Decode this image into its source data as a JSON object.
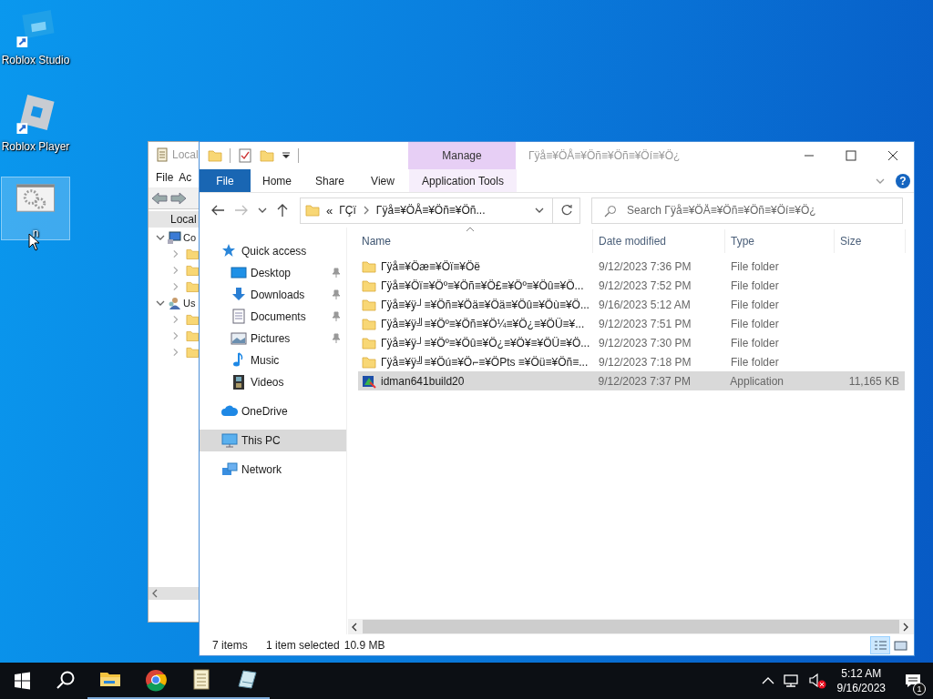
{
  "desktop_icons": [
    {
      "label": "Roblox Studio",
      "kind": "studio",
      "selected": false
    },
    {
      "label": "Roblox Player",
      "kind": "player",
      "selected": false
    },
    {
      "label": "n",
      "kind": "settings",
      "selected": true
    }
  ],
  "background_window": {
    "title": "Local",
    "menu": [
      "File",
      "Ac"
    ],
    "tree_label": "Local",
    "tree": [
      {
        "label": "Co",
        "kind": "computer",
        "expanded": true,
        "children": [
          {
            "expanded": false
          },
          {
            "expanded": false
          },
          {
            "expanded": false
          }
        ]
      },
      {
        "label": "Us",
        "kind": "users",
        "expanded": true,
        "children": [
          {
            "expanded": false
          },
          {
            "expanded": false
          },
          {
            "expanded": false
          }
        ]
      }
    ]
  },
  "explorer": {
    "title": "Γÿå≡¥ÖÅ≡¥Öñ≡¥Öñ≡¥Öí≡¥Ö¿",
    "contextual_header": "Manage",
    "tabs": [
      {
        "label": "File",
        "kind": "file",
        "selected": false
      },
      {
        "label": "Home",
        "kind": "plain",
        "selected": false
      },
      {
        "label": "Share",
        "kind": "plain",
        "selected": false
      },
      {
        "label": "View",
        "kind": "plain",
        "selected": false
      },
      {
        "label": "Application Tools",
        "kind": "contextual",
        "selected": false
      }
    ],
    "help_glyph": "?",
    "address": {
      "overflow": "«",
      "path": [
        "ΓÇï",
        "Γÿå≡¥ÖÅ≡¥Öñ≡¥Öñ..."
      ]
    },
    "search": {
      "placeholder": "Search Γÿå≡¥ÖÅ≡¥Öñ≡¥Öñ≡¥Öí≡¥Ö¿"
    },
    "nav": [
      {
        "label": "Quick access",
        "kind": "quick",
        "selected": false,
        "children": [
          {
            "label": "Desktop",
            "kind": "desktop",
            "pinned": true,
            "selected": false
          },
          {
            "label": "Downloads",
            "kind": "downloads",
            "pinned": true,
            "selected": false
          },
          {
            "label": "Documents",
            "kind": "documents",
            "pinned": true,
            "selected": false
          },
          {
            "label": "Pictures",
            "kind": "pictures",
            "pinned": true,
            "selected": false
          },
          {
            "label": "Music",
            "kind": "music",
            "pinned": false,
            "selected": false
          },
          {
            "label": "Videos",
            "kind": "videos",
            "pinned": false,
            "selected": false
          }
        ]
      },
      {
        "label": "OneDrive",
        "kind": "cloud",
        "selected": false
      },
      {
        "label": "This PC",
        "kind": "pc",
        "selected": true
      },
      {
        "label": "Network",
        "kind": "network",
        "selected": false
      }
    ],
    "columns": [
      {
        "label": "Name",
        "sorted": true
      },
      {
        "label": "Date modified",
        "sorted": false
      },
      {
        "label": "Type",
        "sorted": false
      },
      {
        "label": "Size",
        "sorted": false
      }
    ],
    "rows": [
      {
        "name": "Γÿå≡¥Öæ≡¥Öï≡¥Öë",
        "date": "9/12/2023 7:36 PM",
        "type": "File folder",
        "kind": "folder",
        "selected": false
      },
      {
        "name": "Γÿå≡¥Öï≡¥Öº≡¥Öñ≡¥Ö£≡¥Öº≡¥Öû≡¥Ö...",
        "date": "9/12/2023 7:52 PM",
        "type": "File folder",
        "kind": "folder",
        "selected": false
      },
      {
        "name": "Γÿå≡¥ÿ┘≡¥Öñ≡¥Öä≡¥Öä≡¥Öû≡¥Öù≡¥Ö...",
        "date": "9/16/2023 5:12 AM",
        "type": "File folder",
        "kind": "folder",
        "selected": false
      },
      {
        "name": "Γÿå≡¥ÿ╝≡¥Öº≡¥Öñ≡¥Ö¼≡¥Ö¿≡¥ÖÜ≡¥...",
        "date": "9/12/2023 7:51 PM",
        "type": "File folder",
        "kind": "folder",
        "selected": false
      },
      {
        "name": "Γÿå≡¥ÿ┘≡¥Öº≡¥Öû≡¥Ö¿≡¥Ö¥≡¥ÖÜ≡¥Ö...",
        "date": "9/12/2023 7:30 PM",
        "type": "File folder",
        "kind": "folder",
        "selected": false
      },
      {
        "name": "Γÿå≡¥ÿ╝≡¥Öú≡¥Ö⌐≡¥ÖPts ≡¥Öü≡¥Öñ≡...",
        "date": "9/12/2023 7:18 PM",
        "type": "File folder",
        "kind": "folder",
        "selected": false
      },
      {
        "name": "idman641build20",
        "date": "9/12/2023 7:37 PM",
        "type": "Application",
        "size": "11,165 KB",
        "kind": "app",
        "selected": true
      }
    ],
    "status": {
      "count": "7 items",
      "selection": "1 item selected",
      "size": "10.9 MB"
    },
    "views": [
      {
        "kind": "details",
        "selected": true
      },
      {
        "kind": "tiles",
        "selected": false
      }
    ]
  },
  "taskbar": {
    "apps": [
      {
        "kind": "explorer",
        "running": true
      },
      {
        "kind": "browser",
        "running": true
      },
      {
        "kind": "notepad",
        "running": true
      },
      {
        "kind": "app",
        "running": true
      }
    ],
    "volume_muted": true,
    "time": "5:12 AM",
    "date": "9/16/2023",
    "notifications": "1"
  }
}
